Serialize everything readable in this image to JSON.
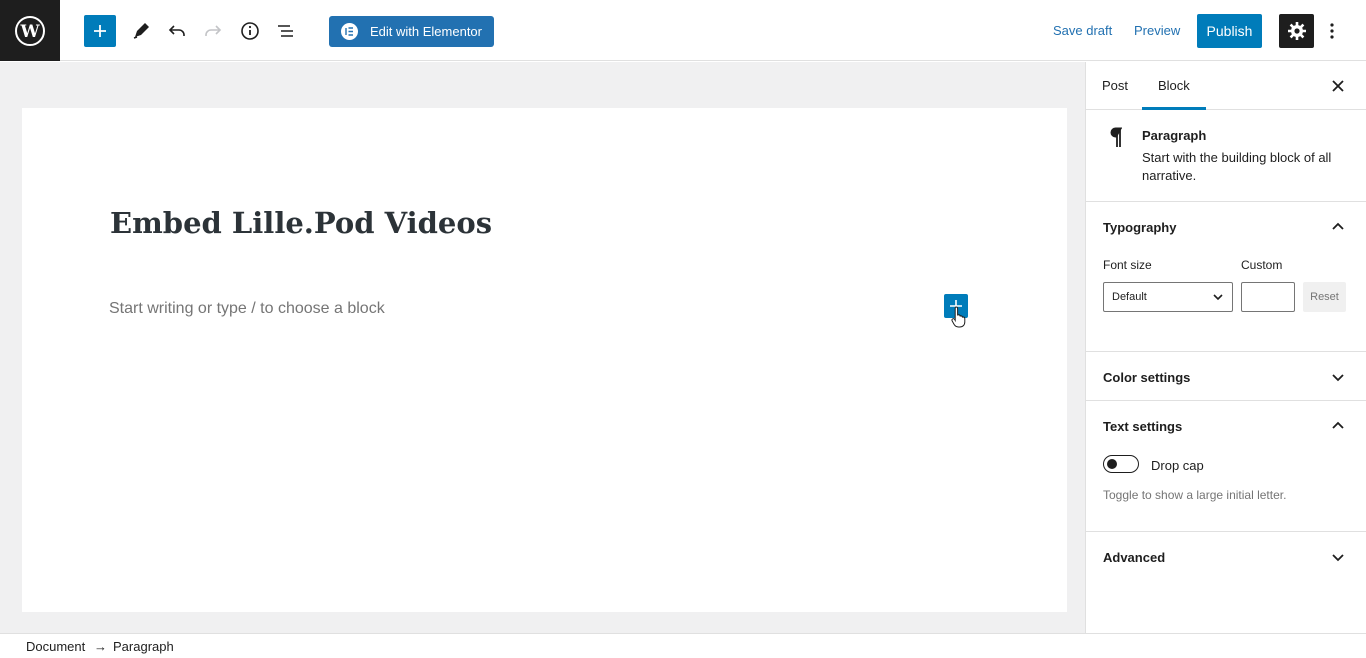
{
  "toolbar": {
    "add_block_label": "Add block",
    "elementor_label": "Edit with Elementor",
    "save_draft_label": "Save draft",
    "preview_label": "Preview",
    "publish_label": "Publish",
    "accent_color": "#007cba"
  },
  "editor": {
    "post_title": "Embed Lille.Pod Videos",
    "placeholder": "Start writing or type / to choose a block"
  },
  "sidebar": {
    "tabs": [
      {
        "label": "Post",
        "active": false
      },
      {
        "label": "Block",
        "active": true
      }
    ],
    "block": {
      "icon": "paragraph-icon",
      "title": "Paragraph",
      "description": "Start with the building block of all narrative."
    },
    "typography": {
      "title": "Typography",
      "font_size_label": "Font size",
      "custom_label": "Custom",
      "font_size_value": "Default",
      "custom_value": "",
      "reset_label": "Reset",
      "expanded": true
    },
    "color_settings": {
      "title": "Color settings",
      "expanded": false
    },
    "text_settings": {
      "title": "Text settings",
      "drop_cap_label": "Drop cap",
      "drop_cap_enabled": false,
      "help": "Toggle to show a large initial letter.",
      "expanded": true
    },
    "advanced": {
      "title": "Advanced",
      "expanded": false
    }
  },
  "footer": {
    "breadcrumb": [
      "Document",
      "Paragraph"
    ],
    "separator": "→"
  }
}
